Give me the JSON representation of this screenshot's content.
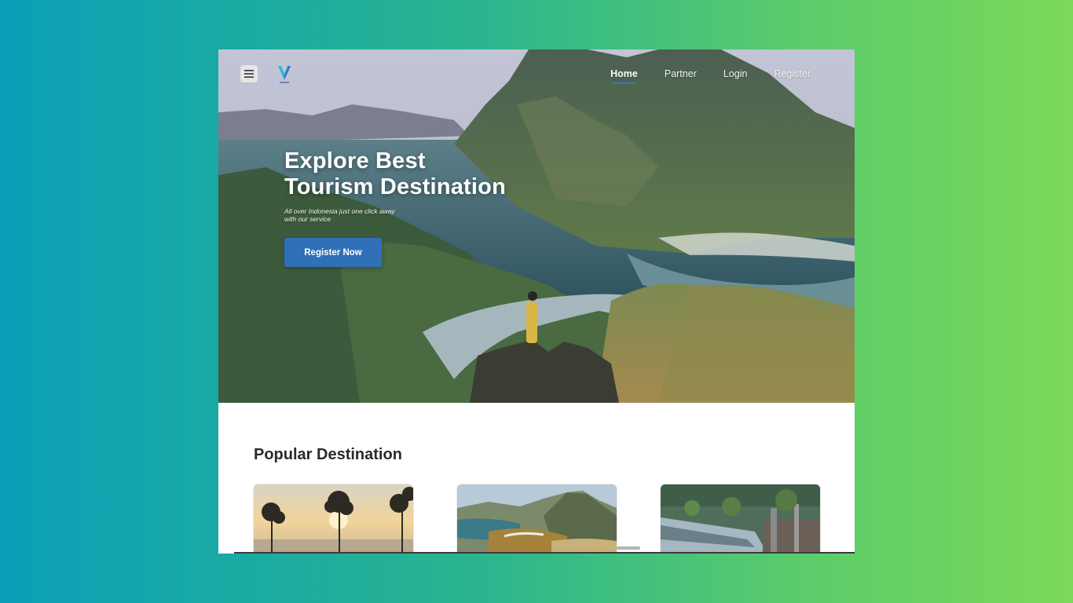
{
  "nav": {
    "items": [
      {
        "label": "Home",
        "active": true
      },
      {
        "label": "Partner",
        "active": false
      },
      {
        "label": "Login",
        "active": false
      },
      {
        "label": "Register",
        "active": false
      }
    ]
  },
  "icons": {
    "menu": "hamburger-menu-icon",
    "logo": "v-logo-icon"
  },
  "hero": {
    "title_line1": "Explore Best",
    "title_line2": "Tourism Destination",
    "subtitle_line1": "All over Indonesia just one click away",
    "subtitle_line2": "with our service",
    "cta_label": "Register Now"
  },
  "popular": {
    "title": "Popular Destination"
  },
  "colors": {
    "accent": "#2f70b8",
    "background_gradient_start": "#0a9fb8",
    "background_gradient_end": "#7bd957"
  }
}
